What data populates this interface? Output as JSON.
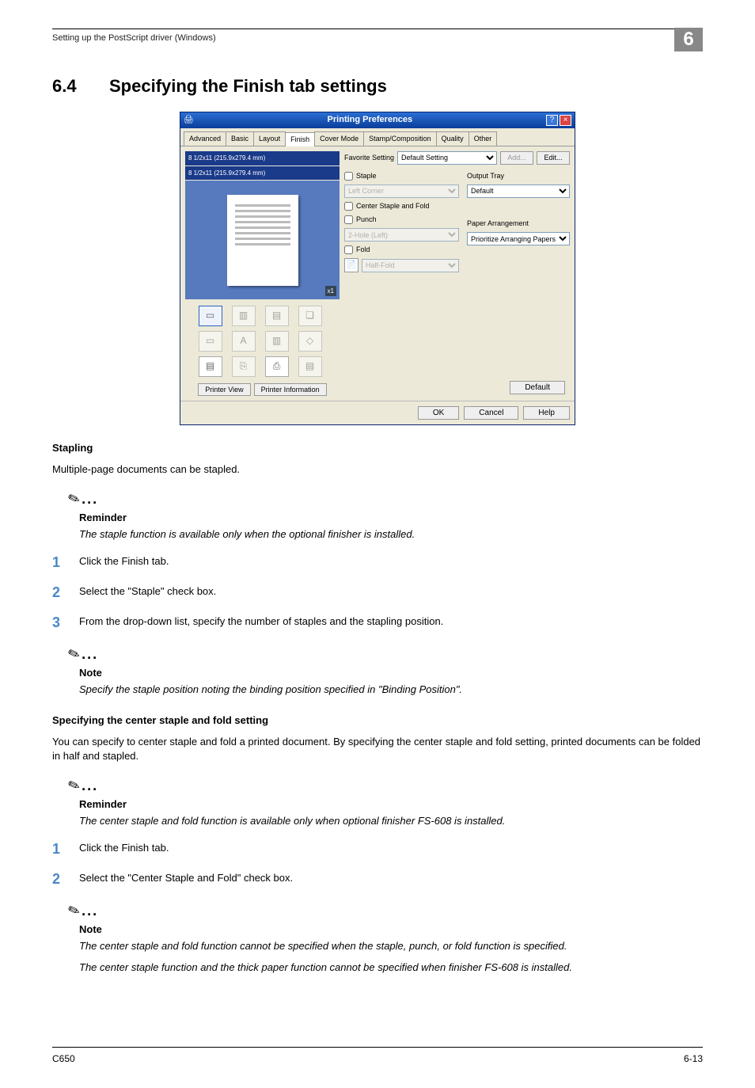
{
  "running_head": "Setting up the PostScript driver (Windows)",
  "chapter_number": "6",
  "section": {
    "number": "6.4",
    "title": "Specifying the Finish tab settings"
  },
  "stapling": {
    "heading": "Stapling",
    "intro": "Multiple-page documents can be stapled.",
    "reminder_head": "Reminder",
    "reminder_text": "The staple function is available only when the optional finisher is installed.",
    "steps": [
      "Click the Finish tab.",
      "Select the \"Staple\" check box.",
      "From the drop-down list, specify the number of staples and the stapling position."
    ],
    "note_head": "Note",
    "note_text": "Specify the staple position noting the binding position specified in \"Binding Position\"."
  },
  "csf": {
    "heading": "Specifying the center staple and fold setting",
    "intro": "You can specify to center staple and fold a printed document. By specifying the center staple and fold setting, printed documents can be folded in half and stapled.",
    "reminder_head": "Reminder",
    "reminder_text": "The center staple and fold function is available only when optional finisher FS-608 is installed.",
    "steps": [
      "Click the Finish tab.",
      "Select the \"Center Staple and Fold\" check box."
    ],
    "note_head": "Note",
    "note_text1": "The center staple and fold function cannot be specified when the staple, punch, or fold function is specified.",
    "note_text2": "The center staple function and the thick paper function cannot be specified when finisher FS-608 is installed."
  },
  "footer": {
    "left": "C650",
    "right": "6-13"
  },
  "dialog": {
    "title": "Printing Preferences",
    "tabs": [
      "Advanced",
      "Basic",
      "Layout",
      "Finish",
      "Cover Mode",
      "Stamp/Composition",
      "Quality",
      "Other"
    ],
    "active_tab": "Finish",
    "paper_top": "8 1/2x11 (215.9x279.4 mm)",
    "paper_bottom": "8 1/2x11 (215.9x279.4 mm)",
    "zoom_badge": "x1",
    "printer_view": "Printer View",
    "printer_info": "Printer Information",
    "fav_label": "Favorite Setting",
    "fav_value": "Default Setting",
    "add_btn": "Add...",
    "edit_btn": "Edit...",
    "staple_label": "Staple",
    "staple_pos": "Left Corner",
    "csf_label": "Center Staple and Fold",
    "punch_label": "Punch",
    "punch_opt": "2-Hole (Left)",
    "fold_label": "Fold",
    "fold_opt": "Half-Fold",
    "outtray_label": "Output Tray",
    "outtray_value": "Default",
    "paperarr_label": "Paper Arrangement",
    "paperarr_value": "Prioritize Arranging Papers",
    "default_btn": "Default",
    "ok": "OK",
    "cancel": "Cancel",
    "help": "Help"
  }
}
